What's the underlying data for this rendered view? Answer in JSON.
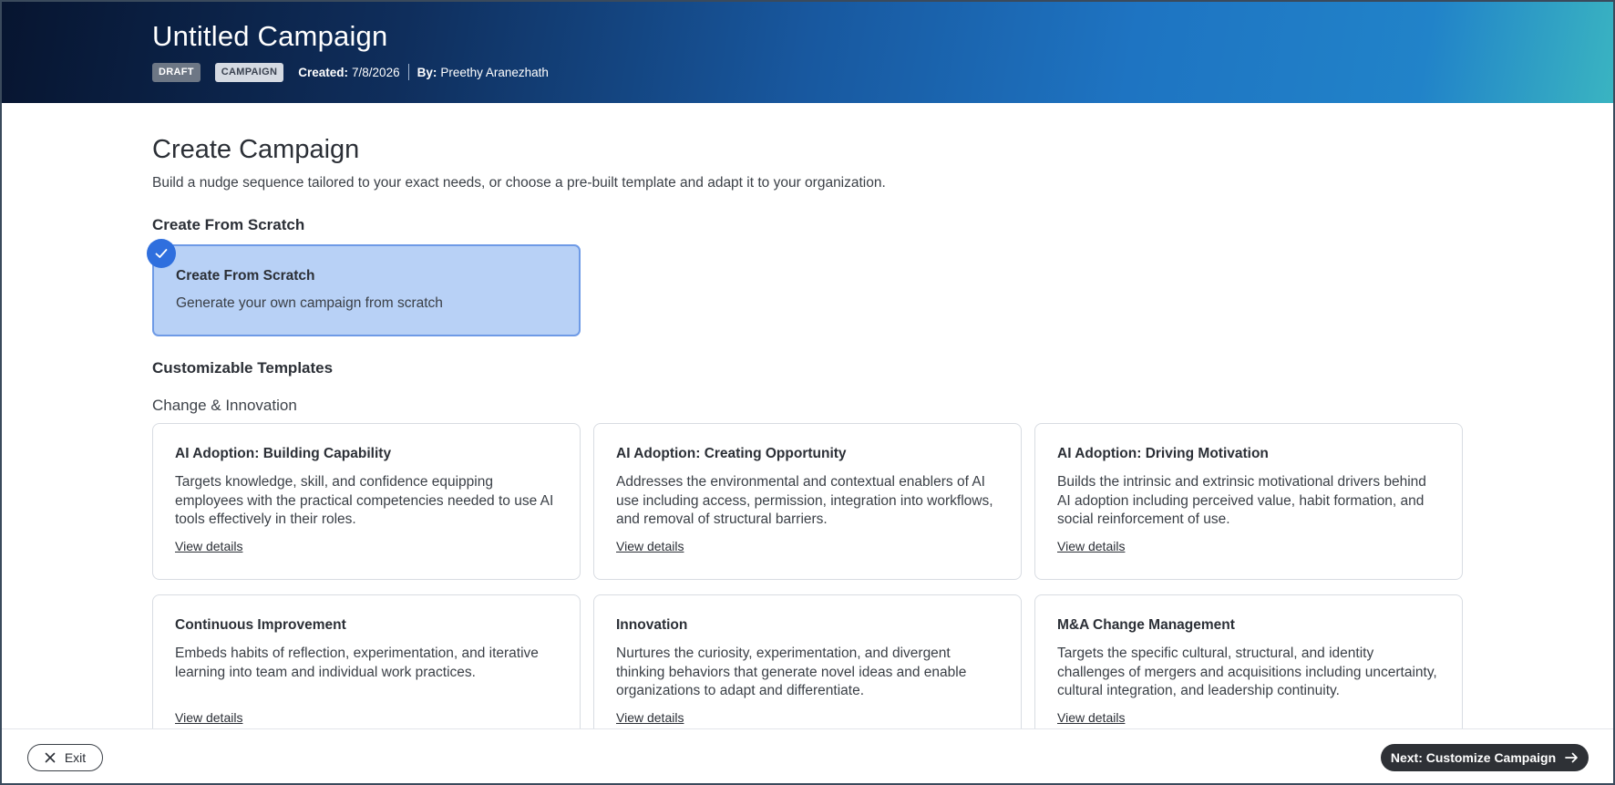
{
  "header": {
    "title": "Untitled Campaign",
    "badges": {
      "draft": "DRAFT",
      "campaign": "CAMPAIGN"
    },
    "created_label": "Created:",
    "created_value": "7/8/2026",
    "by_label": "By:",
    "by_value": "Preethy Aranezhath"
  },
  "page": {
    "title": "Create Campaign",
    "subtitle": "Build a nudge sequence tailored to your exact needs, or choose a pre-built template and adapt it to your organization."
  },
  "scratch": {
    "heading": "Create From Scratch",
    "card_title": "Create From Scratch",
    "card_desc": "Generate your own campaign from scratch",
    "selected": true
  },
  "templates": {
    "heading": "Customizable Templates",
    "category": "Change & Innovation",
    "view_details_label": "View details",
    "cards": [
      {
        "title": "AI Adoption: Building Capability",
        "desc": "Targets knowledge, skill, and confidence equipping employees with the practical competencies needed to use AI tools effectively in their roles."
      },
      {
        "title": "AI Adoption: Creating Opportunity",
        "desc": "Addresses the environmental and contextual enablers of AI use including access, permission, integration into workflows, and removal of structural barriers."
      },
      {
        "title": "AI Adoption: Driving Motivation",
        "desc": "Builds the intrinsic and extrinsic motivational drivers behind AI adoption including perceived value, habit formation, and social reinforcement of use."
      },
      {
        "title": "Continuous Improvement",
        "desc": "Embeds habits of reflection, experimentation, and iterative learning into team and individual work practices."
      },
      {
        "title": "Innovation",
        "desc": "Nurtures the curiosity, experimentation, and divergent thinking behaviors that generate novel ideas and enable organizations to adapt and differentiate."
      },
      {
        "title": "M&A Change Management",
        "desc": "Targets the specific cultural, structural, and identity challenges of mergers and acquisitions including uncertainty, cultural integration, and leadership continuity."
      }
    ]
  },
  "footer": {
    "exit_label": "Exit",
    "next_label": "Next: Customize Campaign"
  },
  "icons": {
    "check": "check-icon",
    "close": "close-icon",
    "arrow": "arrow-right-icon"
  },
  "colors": {
    "selected_card_bg": "#b8d1f6",
    "selected_card_border": "#6e9ae6",
    "check_badge": "#2f6fde",
    "primary_button": "#2e3136"
  }
}
